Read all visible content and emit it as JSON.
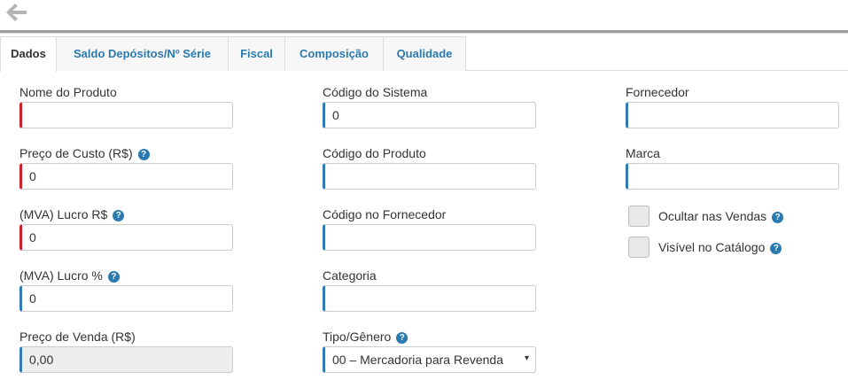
{
  "icons": {
    "back": "arrow-left-icon",
    "help": "question-circle-icon"
  },
  "colors": {
    "accent": "#2a7ab0",
    "required": "#d0202e",
    "optional": "#2f7cb8"
  },
  "tabs": [
    {
      "label": "Dados",
      "active": true
    },
    {
      "label": "Saldo Depósitos/Nº Série"
    },
    {
      "label": "Fiscal"
    },
    {
      "label": "Composição"
    },
    {
      "label": "Qualidade"
    }
  ],
  "help_glyph": "?",
  "caret_glyph": "▾",
  "fields": {
    "nome_produto": {
      "label": "Nome do Produto",
      "value": ""
    },
    "preco_custo": {
      "label": "Preço de Custo (R$)",
      "value": "0"
    },
    "mva_lucro_rs": {
      "label": "(MVA) Lucro R$",
      "value": "0"
    },
    "mva_lucro_pct": {
      "label": "(MVA) Lucro %",
      "value": "0"
    },
    "preco_venda": {
      "label": "Preço de Venda (R$)",
      "value": "0,00"
    },
    "codigo_sistema": {
      "label": "Código do Sistema",
      "value": "0"
    },
    "codigo_produto": {
      "label": "Código do Produto",
      "value": ""
    },
    "codigo_fornecedor": {
      "label": "Código no Fornecedor",
      "value": ""
    },
    "categoria": {
      "label": "Categoria",
      "value": ""
    },
    "tipo_genero": {
      "label": "Tipo/Gênero",
      "value": "00 – Mercadoria para Revenda"
    },
    "fornecedor": {
      "label": "Fornecedor",
      "value": ""
    },
    "marca": {
      "label": "Marca",
      "value": ""
    }
  },
  "checkboxes": {
    "ocultar_vendas": {
      "label": "Ocultar nas Vendas",
      "checked": false
    },
    "visivel_catalogo": {
      "label": "Visível no Catálogo",
      "checked": false
    }
  }
}
